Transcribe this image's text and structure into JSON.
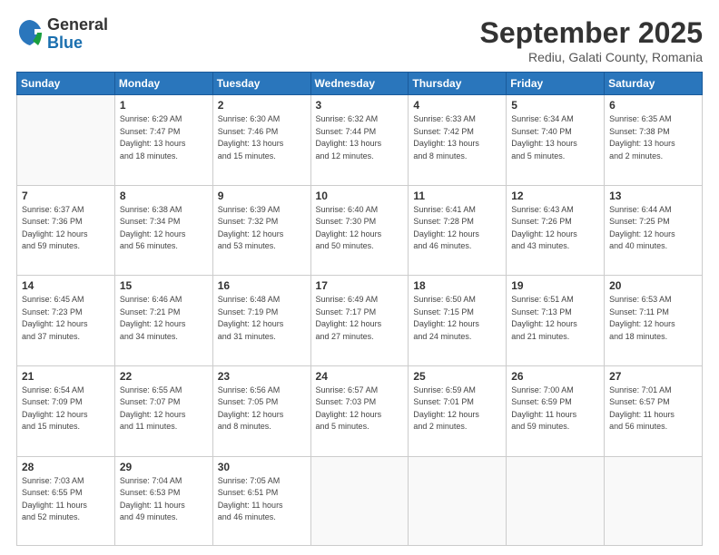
{
  "logo": {
    "general": "General",
    "blue": "Blue"
  },
  "title": "September 2025",
  "subtitle": "Rediu, Galati County, Romania",
  "weekdays": [
    "Sunday",
    "Monday",
    "Tuesday",
    "Wednesday",
    "Thursday",
    "Friday",
    "Saturday"
  ],
  "weeks": [
    [
      {
        "day": "",
        "info": ""
      },
      {
        "day": "1",
        "info": "Sunrise: 6:29 AM\nSunset: 7:47 PM\nDaylight: 13 hours\nand 18 minutes."
      },
      {
        "day": "2",
        "info": "Sunrise: 6:30 AM\nSunset: 7:46 PM\nDaylight: 13 hours\nand 15 minutes."
      },
      {
        "day": "3",
        "info": "Sunrise: 6:32 AM\nSunset: 7:44 PM\nDaylight: 13 hours\nand 12 minutes."
      },
      {
        "day": "4",
        "info": "Sunrise: 6:33 AM\nSunset: 7:42 PM\nDaylight: 13 hours\nand 8 minutes."
      },
      {
        "day": "5",
        "info": "Sunrise: 6:34 AM\nSunset: 7:40 PM\nDaylight: 13 hours\nand 5 minutes."
      },
      {
        "day": "6",
        "info": "Sunrise: 6:35 AM\nSunset: 7:38 PM\nDaylight: 13 hours\nand 2 minutes."
      }
    ],
    [
      {
        "day": "7",
        "info": "Sunrise: 6:37 AM\nSunset: 7:36 PM\nDaylight: 12 hours\nand 59 minutes."
      },
      {
        "day": "8",
        "info": "Sunrise: 6:38 AM\nSunset: 7:34 PM\nDaylight: 12 hours\nand 56 minutes."
      },
      {
        "day": "9",
        "info": "Sunrise: 6:39 AM\nSunset: 7:32 PM\nDaylight: 12 hours\nand 53 minutes."
      },
      {
        "day": "10",
        "info": "Sunrise: 6:40 AM\nSunset: 7:30 PM\nDaylight: 12 hours\nand 50 minutes."
      },
      {
        "day": "11",
        "info": "Sunrise: 6:41 AM\nSunset: 7:28 PM\nDaylight: 12 hours\nand 46 minutes."
      },
      {
        "day": "12",
        "info": "Sunrise: 6:43 AM\nSunset: 7:26 PM\nDaylight: 12 hours\nand 43 minutes."
      },
      {
        "day": "13",
        "info": "Sunrise: 6:44 AM\nSunset: 7:25 PM\nDaylight: 12 hours\nand 40 minutes."
      }
    ],
    [
      {
        "day": "14",
        "info": "Sunrise: 6:45 AM\nSunset: 7:23 PM\nDaylight: 12 hours\nand 37 minutes."
      },
      {
        "day": "15",
        "info": "Sunrise: 6:46 AM\nSunset: 7:21 PM\nDaylight: 12 hours\nand 34 minutes."
      },
      {
        "day": "16",
        "info": "Sunrise: 6:48 AM\nSunset: 7:19 PM\nDaylight: 12 hours\nand 31 minutes."
      },
      {
        "day": "17",
        "info": "Sunrise: 6:49 AM\nSunset: 7:17 PM\nDaylight: 12 hours\nand 27 minutes."
      },
      {
        "day": "18",
        "info": "Sunrise: 6:50 AM\nSunset: 7:15 PM\nDaylight: 12 hours\nand 24 minutes."
      },
      {
        "day": "19",
        "info": "Sunrise: 6:51 AM\nSunset: 7:13 PM\nDaylight: 12 hours\nand 21 minutes."
      },
      {
        "day": "20",
        "info": "Sunrise: 6:53 AM\nSunset: 7:11 PM\nDaylight: 12 hours\nand 18 minutes."
      }
    ],
    [
      {
        "day": "21",
        "info": "Sunrise: 6:54 AM\nSunset: 7:09 PM\nDaylight: 12 hours\nand 15 minutes."
      },
      {
        "day": "22",
        "info": "Sunrise: 6:55 AM\nSunset: 7:07 PM\nDaylight: 12 hours\nand 11 minutes."
      },
      {
        "day": "23",
        "info": "Sunrise: 6:56 AM\nSunset: 7:05 PM\nDaylight: 12 hours\nand 8 minutes."
      },
      {
        "day": "24",
        "info": "Sunrise: 6:57 AM\nSunset: 7:03 PM\nDaylight: 12 hours\nand 5 minutes."
      },
      {
        "day": "25",
        "info": "Sunrise: 6:59 AM\nSunset: 7:01 PM\nDaylight: 12 hours\nand 2 minutes."
      },
      {
        "day": "26",
        "info": "Sunrise: 7:00 AM\nSunset: 6:59 PM\nDaylight: 11 hours\nand 59 minutes."
      },
      {
        "day": "27",
        "info": "Sunrise: 7:01 AM\nSunset: 6:57 PM\nDaylight: 11 hours\nand 56 minutes."
      }
    ],
    [
      {
        "day": "28",
        "info": "Sunrise: 7:03 AM\nSunset: 6:55 PM\nDaylight: 11 hours\nand 52 minutes."
      },
      {
        "day": "29",
        "info": "Sunrise: 7:04 AM\nSunset: 6:53 PM\nDaylight: 11 hours\nand 49 minutes."
      },
      {
        "day": "30",
        "info": "Sunrise: 7:05 AM\nSunset: 6:51 PM\nDaylight: 11 hours\nand 46 minutes."
      },
      {
        "day": "",
        "info": ""
      },
      {
        "day": "",
        "info": ""
      },
      {
        "day": "",
        "info": ""
      },
      {
        "day": "",
        "info": ""
      }
    ]
  ]
}
